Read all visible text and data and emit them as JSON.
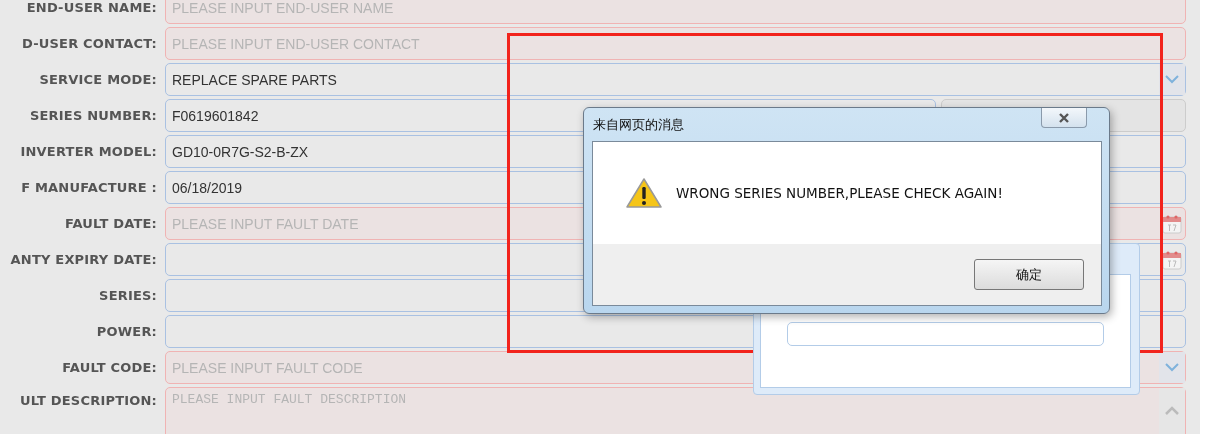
{
  "form": {
    "rows": [
      {
        "label": "END-USER NAME:",
        "kind": "text",
        "placeholder": "PLEASE INPUT END-USER NAME",
        "error": true
      },
      {
        "label": "D-USER CONTACT:",
        "kind": "text",
        "placeholder": "PLEASE INPUT END-USER CONTACT",
        "error": true
      },
      {
        "label": "SERVICE MODE:",
        "kind": "select",
        "value": "REPLACE SPARE PARTS",
        "error": false
      },
      {
        "label": "SERIES NUMBER:",
        "kind": "text_button",
        "value": "F0619601842",
        "error": false
      },
      {
        "label": "INVERTER MODEL:",
        "kind": "text",
        "value": "GD10-0R7G-S2-B-ZX",
        "error": false
      },
      {
        "label": "F MANUFACTURE :",
        "kind": "text",
        "value": "06/18/2019",
        "error": false
      },
      {
        "label": "FAULT DATE:",
        "kind": "date",
        "placeholder": "PLEASE INPUT FAULT DATE",
        "error": true
      },
      {
        "label": "ANTY EXPIRY DATE:",
        "kind": "date",
        "error": false
      },
      {
        "label": "SERIES:",
        "kind": "text",
        "error": false
      },
      {
        "label": "POWER:",
        "kind": "text",
        "error": false
      },
      {
        "label": "FAULT CODE:",
        "kind": "select",
        "placeholder": "PLEASE INPUT  FAULT CODE",
        "error": true
      },
      {
        "label": "ULT DESCRIPTION:",
        "kind": "textarea",
        "placeholder": "PLEASE INPUT FAULT DESCRIPTION",
        "error": true
      }
    ]
  },
  "dialog": {
    "title": "来自网页的消息",
    "message": "WRONG SERIES NUMBER,PLEASE CHECK AGAIN!",
    "button": "确定"
  }
}
